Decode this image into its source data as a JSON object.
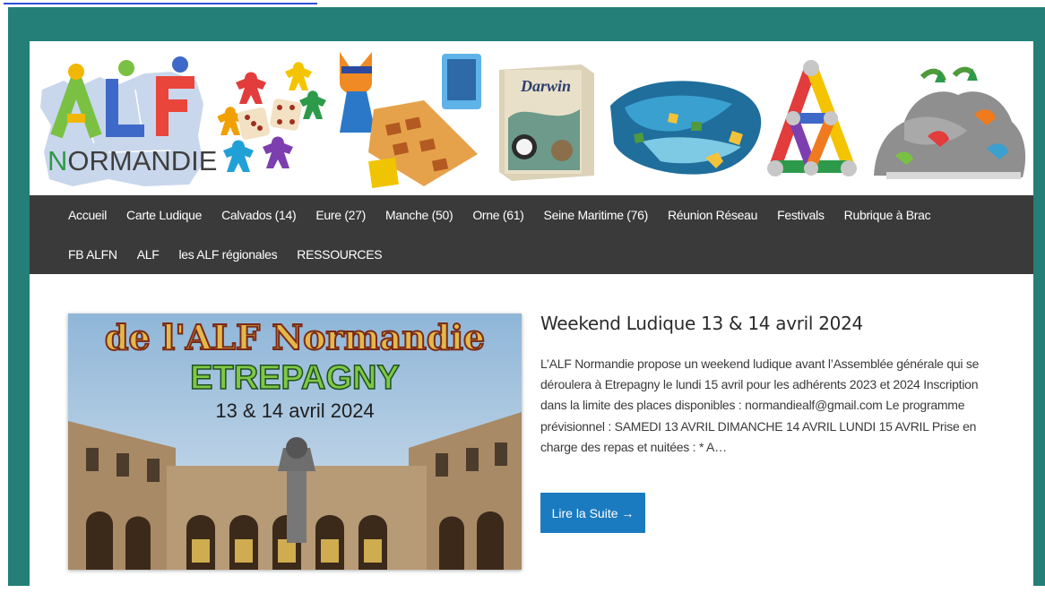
{
  "skip_link": "",
  "logo": {
    "wordmark_n": "N",
    "wordmark_rest": "ORMANDIE",
    "letters": [
      "A",
      "L",
      "F"
    ]
  },
  "banner": {
    "darwin_box_title": "Darwin"
  },
  "nav": {
    "row1": [
      "Accueil",
      "Carte Ludique",
      "Calvados (14)",
      "Eure (27)",
      "Manche (50)",
      "Orne (61)",
      "Seine Maritime (76)",
      "Réunion Réseau",
      "Festivals",
      "Rubrique à Brac"
    ],
    "row2": [
      "FB ALFN",
      "ALF",
      "les ALF régionales",
      "RESSOURCES"
    ]
  },
  "post": {
    "title": "Weekend Ludique 13 & 14 avril 2024",
    "excerpt": "L’ALF Normandie propose un weekend ludique avant l’Assemblée générale qui se déroulera à Etrepagny le lundi 15 avril pour les adhérents 2023 et 2024 Inscription dans la limite des places disponibles : normandiealf@gmail.com Le programme prévisionnel : SAMEDI 13 AVRIL DIMANCHE 14 AVRIL LUNDI 15 AVRIL Prise en charge des repas et nuitées : * A…",
    "read_more": "Lire la Suite →",
    "image": {
      "line1": "de l'ALF Normandie",
      "line2": "ETREPAGNY",
      "line3": "13 & 14 avril 2024"
    }
  },
  "colors": {
    "frame": "#237f78",
    "nav_bg": "#3a3a3a",
    "button": "#1b7bc0"
  }
}
